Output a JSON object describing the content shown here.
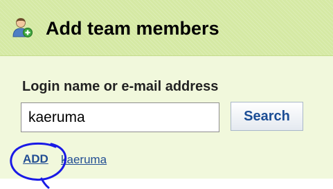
{
  "header": {
    "title": "Add team members",
    "icon": "user-add-icon"
  },
  "form": {
    "label": "Login name or e-mail address",
    "input_value": "kaeruma",
    "search_label": "Search"
  },
  "results": {
    "add_label": "ADD",
    "username": "kaeruma"
  },
  "annotation": {
    "shape": "hand-drawn circle",
    "color": "#1a1ae6"
  },
  "colors": {
    "header_bg": "#d5e9a4",
    "panel_bg": "#f1f8dc",
    "link": "#224e93"
  }
}
